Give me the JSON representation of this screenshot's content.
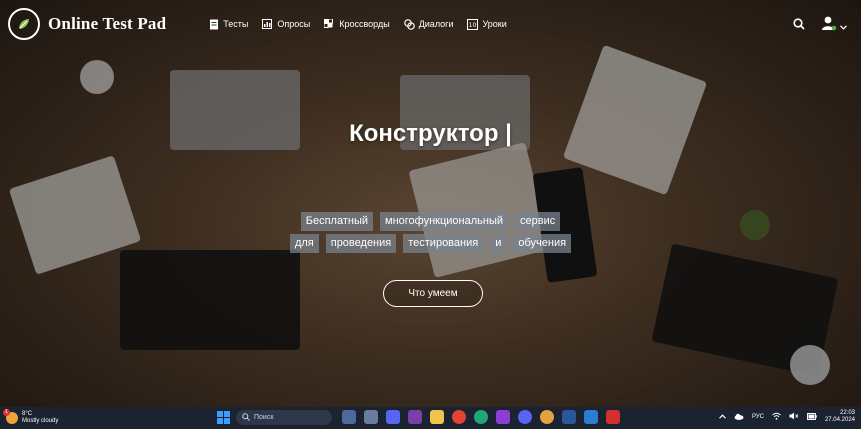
{
  "brand": {
    "name": "Online Test Pad",
    "icon": "leaf-logo-icon"
  },
  "nav": {
    "items": [
      {
        "label": "Тесты",
        "icon": "document-icon"
      },
      {
        "label": "Опросы",
        "icon": "poll-icon"
      },
      {
        "label": "Кроссворды",
        "icon": "crossword-icon"
      },
      {
        "label": "Диалоги",
        "icon": "chat-icon"
      },
      {
        "label": "Уроки",
        "icon": "lessons-icon"
      }
    ]
  },
  "hero": {
    "title": "Конструктор |",
    "tags_row1": [
      "Бесплатный",
      "многофункциональный",
      "сервис"
    ],
    "tags_row2": [
      "для",
      "проведения",
      "тестирования",
      "и",
      "обучения"
    ],
    "cta": "Что умеем"
  },
  "taskbar": {
    "weather_temp": "8°C",
    "weather_desc": "Mostly cloudy",
    "weather_badge": "1",
    "search_placeholder": "Поиск",
    "lang": "РУС",
    "time": "22:03",
    "date": "27.04.2024"
  }
}
